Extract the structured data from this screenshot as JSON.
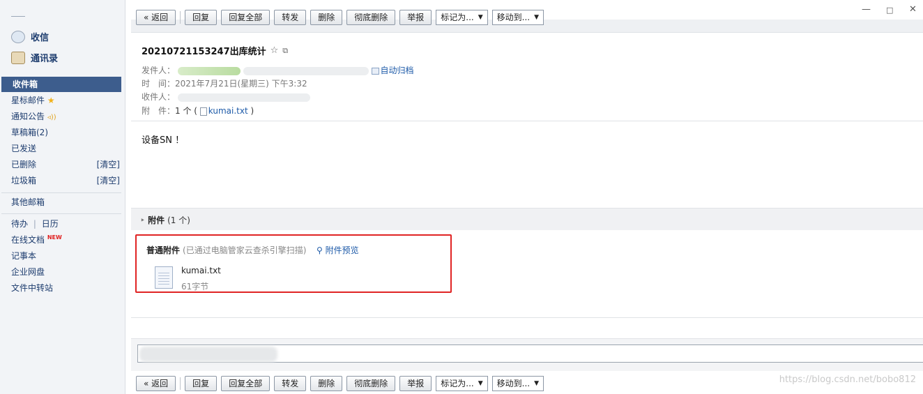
{
  "window": {
    "minimize_icon": "minimize-icon",
    "maximize_icon": "maximize-icon",
    "close_icon": "close-icon"
  },
  "sidebar": {
    "top_items": [
      {
        "label": "收信",
        "icon": "inbox-receive-icon"
      },
      {
        "label": "通讯录",
        "icon": "contacts-icon"
      }
    ],
    "folders": [
      {
        "label": "收件箱"
      },
      {
        "label": "星标邮件"
      },
      {
        "label": "通知公告"
      },
      {
        "label": "草稿箱(2)"
      },
      {
        "label": "已发送"
      },
      {
        "label": "已删除",
        "action": "[清空]"
      },
      {
        "label": "垃圾箱",
        "action": "[清空]"
      },
      {
        "label": "其他邮箱"
      },
      {
        "label": "待办",
        "label2": "日历",
        "divider": "|"
      },
      {
        "label": "在线文档",
        "badge": "NEW"
      },
      {
        "label": "记事本"
      },
      {
        "label": "企业网盘"
      },
      {
        "label": "文件中转站"
      }
    ]
  },
  "toolbar": {
    "back": "« 返回",
    "reply": "回复",
    "reply_all": "回复全部",
    "forward": "转发",
    "delete": "删除",
    "delete_permanent": "彻底删除",
    "report": "举报",
    "mark_as": "标记为...",
    "move_to": "移动到..."
  },
  "message": {
    "subject": "20210721153247出库统计",
    "from_label": "发件人：",
    "auto_archive": "自动归档",
    "time_label": "时　间：",
    "time_value": "2021年7月21日(星期三) 下午3:32",
    "to_label": "收件人：",
    "attach_label": "附　件：",
    "attach_count": "1 个 (",
    "attach_close": ")",
    "attach_file": "kumai.txt",
    "body": "设备SN ！"
  },
  "attachments": {
    "header_bold": "附件",
    "header_count": "(1 个)",
    "type_label": "普通附件",
    "scan_note": "(已通过电脑管家云查杀引擎扫描)",
    "preview": "附件预览",
    "file_name": "kumai.txt",
    "file_size": "61字节"
  },
  "watermark": "https://blog.csdn.net/bobo812"
}
